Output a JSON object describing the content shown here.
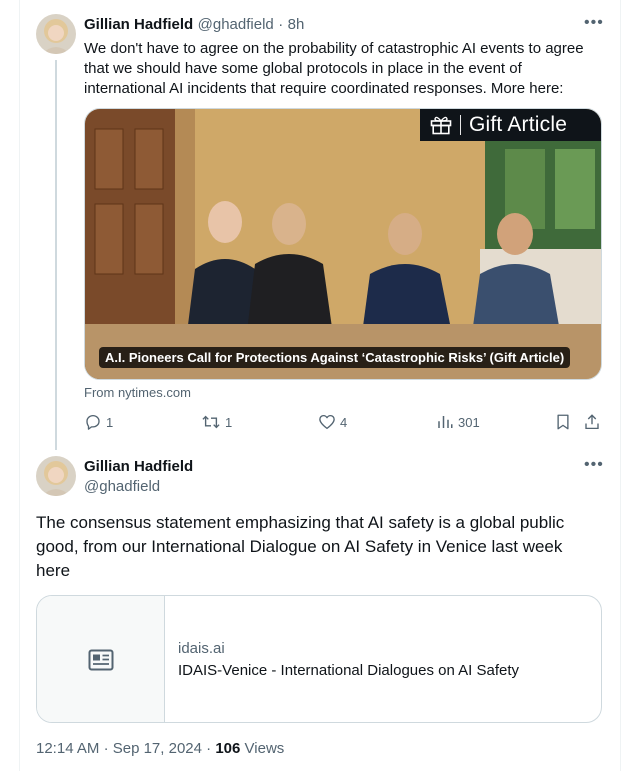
{
  "tweet1": {
    "author_name": "Gillian Hadfield",
    "author_handle": "@ghadfield",
    "separator": "·",
    "time": "8h",
    "more": "•••",
    "text": "We don't have to agree on the probability of catastrophic AI events to agree that we should have some global protocols in place in the event of international AI incidents that require coordinated responses. More here:",
    "card": {
      "badge": "Gift Article",
      "caption": "A.I. Pioneers Call for Protections Against ‘Catastrophic Risks’ (Gift Article)",
      "source": "From nytimes.com"
    },
    "actions": {
      "replies": "1",
      "reposts": "1",
      "likes": "4",
      "views": "301"
    }
  },
  "tweet2": {
    "author_name": "Gillian Hadfield",
    "author_handle": "@ghadfield",
    "more": "•••",
    "text": "The consensus statement emphasizing that AI safety is a global public good, from our International Dialogue on AI Safety in Venice last week here",
    "link_card": {
      "domain": "idais.ai",
      "title": "IDAIS-Venice - International Dialogues on AI Safety"
    },
    "meta": {
      "time": "12:14 AM",
      "dot1": "·",
      "date": "Sep 17, 2024",
      "dot2": "·",
      "views_count": "106",
      "views_label": "Views"
    }
  },
  "icons": {
    "reply": "reply-icon",
    "repost": "repost-icon",
    "like": "heart-icon",
    "views": "analytics-icon",
    "bookmark": "bookmark-icon",
    "share": "share-icon",
    "gift": "gift-icon",
    "article": "article-icon"
  },
  "colors": {
    "text_primary": "#0f1419",
    "text_secondary": "#536471",
    "border": "#cfd9de"
  }
}
